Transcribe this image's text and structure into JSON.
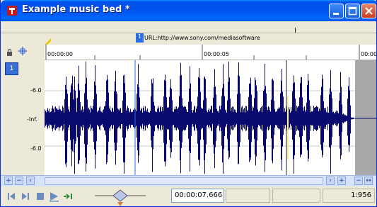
{
  "window": {
    "title": "Example music bed *"
  },
  "region": {
    "number": "1",
    "label": "URL:http://www.sony.com/mediasoftware"
  },
  "track": {
    "number": "1",
    "db_labels": [
      "-6.0",
      "-Inf.",
      "-6.0"
    ]
  },
  "ruler": {
    "labels": [
      "00:00:00",
      "00:00:05",
      "00:00"
    ]
  },
  "transport": {
    "position": "00:00:07.666",
    "field2": "",
    "field3": "",
    "zoom_ratio": "1:956"
  },
  "colors": {
    "waveform": "#0a0a6e",
    "cursor": "#2a6ee8",
    "selection_end": "#909090"
  }
}
